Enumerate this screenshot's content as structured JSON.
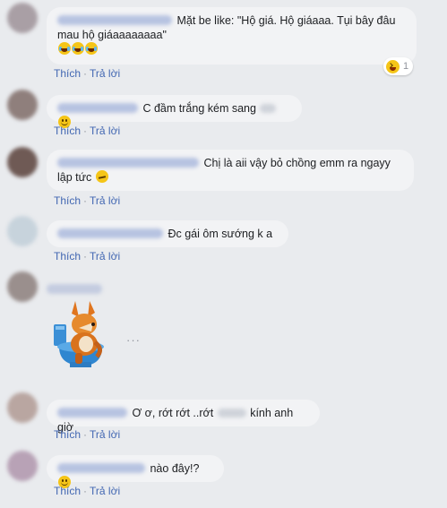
{
  "comments": [
    {
      "text": "Mặt be like: \"Hộ giá. Hộ giáaaa. Tụi bây đâu mau hộ giáaaaaaaaa\"",
      "emoji_icons": [
        "laughing-tears-icon",
        "laughing-tears-icon",
        "laughing-tears-icon"
      ],
      "reaction_count": "1",
      "reaction_icon": "laughing-squint-icon"
    },
    {
      "text": "C đầm trắng kém sang",
      "emoji_icon": "smile-icon"
    },
    {
      "text": "Chị là aii vậy bỏ chồng emm ra ngayy lập tức",
      "emoji_icon": "smirk-icon"
    },
    {
      "text": "Đc gái ôm sướng k a"
    },
    {
      "sticker": "fox-on-toilet-sticker",
      "more": "···"
    },
    {
      "text_a": "Ơ ơ, rớt rớt ..rớt",
      "text_b": "kính anh giờ"
    },
    {
      "text": "nào đây!?",
      "emoji_icon": "smile-icon"
    }
  ],
  "actions": {
    "like": "Thích",
    "reply": "Trả lời",
    "separator": "·"
  },
  "colors": {
    "background": "#e9ebee",
    "bubble": "#f2f3f5",
    "link": "#4267b2"
  }
}
